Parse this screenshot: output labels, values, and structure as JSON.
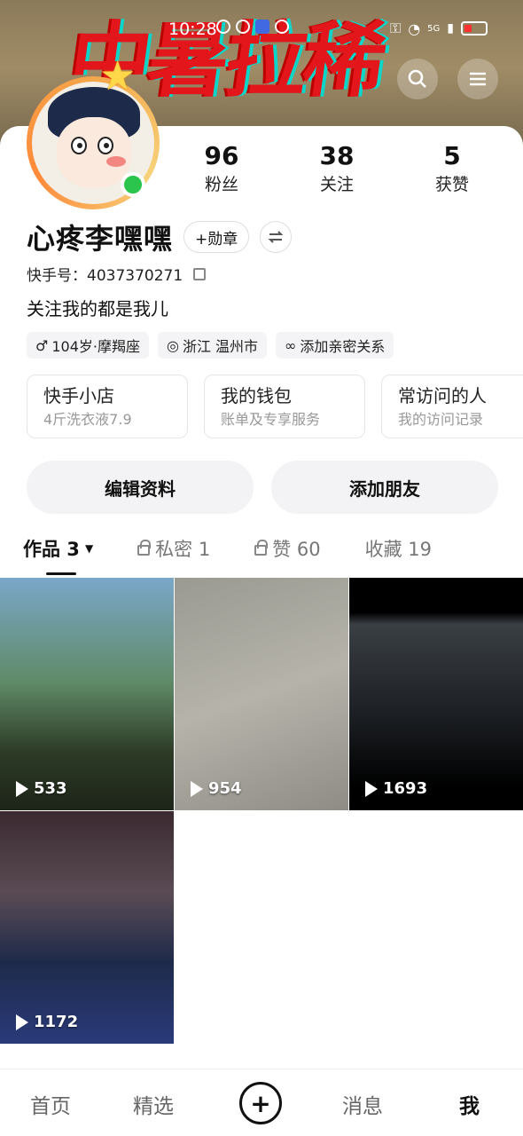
{
  "status_bar": {
    "time": "10:28",
    "network": "5G"
  },
  "banner": {
    "title": "中暑拉稀"
  },
  "header": {
    "search_icon": "search-icon",
    "menu_icon": "menu-icon"
  },
  "profile": {
    "nickname": "心疼李嘿嘿",
    "badge_label": "+勋章",
    "uid": "快手号：4037370271",
    "bio": "关注我的都是我儿",
    "stats": [
      {
        "value": "96",
        "label": "粉丝"
      },
      {
        "value": "38",
        "label": "关注"
      },
      {
        "value": "5",
        "label": "获赞"
      }
    ],
    "tags": [
      {
        "icon": "male-icon",
        "text": "104岁·摩羯座"
      },
      {
        "icon": "location-icon",
        "text": "浙江 温州市"
      },
      {
        "icon": "link-icon",
        "text": "添加亲密关系"
      }
    ]
  },
  "cards": [
    {
      "title": "快手小店",
      "sub": "4斤洗衣液7.9"
    },
    {
      "title": "我的钱包",
      "sub": "账单及专享服务"
    },
    {
      "title": "常访问的人",
      "sub": "我的访问记录"
    }
  ],
  "actions": {
    "edit": "编辑资料",
    "add_friend": "添加朋友"
  },
  "tabs": [
    {
      "label": "作品 3",
      "active": true
    },
    {
      "label": "私密 1",
      "locked": true
    },
    {
      "label": "赞 60",
      "locked": true
    },
    {
      "label": "收藏 19"
    }
  ],
  "videos": [
    {
      "plays": "533"
    },
    {
      "plays": "954"
    },
    {
      "plays": "1693"
    },
    {
      "plays": "1172"
    }
  ],
  "bottom_nav": {
    "home": "首页",
    "featured": "精选",
    "messages": "消息",
    "me": "我"
  },
  "colors": {
    "online": "#2bc44d",
    "banner_text": "#e3161c"
  }
}
